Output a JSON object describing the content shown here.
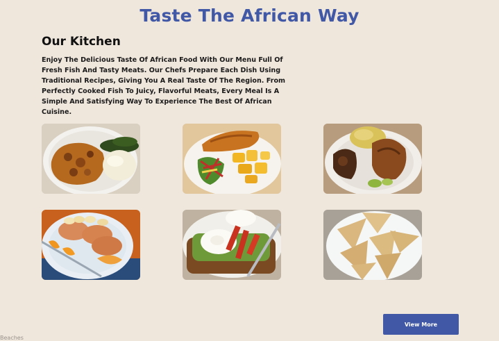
{
  "header": {
    "title": "Taste The African Way"
  },
  "kitchen": {
    "heading": "Our Kitchen",
    "description": "Enjoy The Delicious Taste Of African Food With Our Menu Full Of Fresh Fish And Tasty Meats. Our Chefs Prepare Each Dish Using Traditional Recipes, Giving You A Real Taste Of The Region. From Perfectly Cooked Fish To Juicy, Flavorful Meats, Every Meal Is A Simple And Satisfying Way To Experience The Best Of African Cuisine."
  },
  "gallery": {
    "dishes": [
      {
        "photo": "stew-with-ugali-and-greens"
      },
      {
        "photo": "fried-fish-with-potatoes-and-salad"
      },
      {
        "photo": "grilled-meat-with-mashed-potato"
      },
      {
        "photo": "pancakes-with-fruit"
      },
      {
        "photo": "poached-eggs-on-toast-with-avocado"
      },
      {
        "photo": "samosas"
      }
    ]
  },
  "actions": {
    "view_more_label": "View More"
  },
  "footer": {
    "peek_text": "Beaches"
  },
  "colors": {
    "accent": "#4158a6",
    "background": "#efe6dc",
    "text": "#111111"
  }
}
